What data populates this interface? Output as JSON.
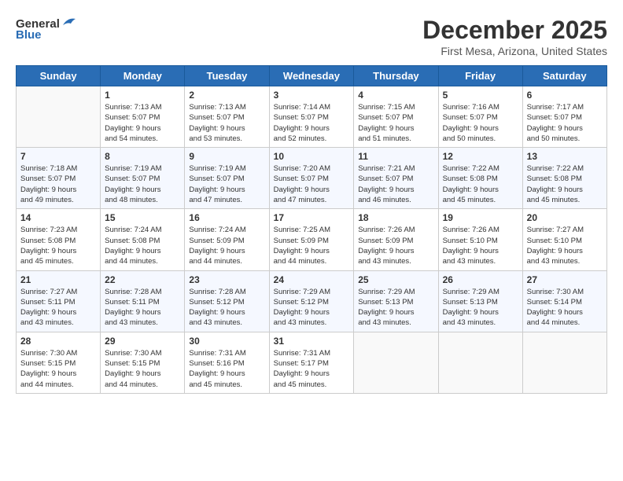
{
  "header": {
    "logo_line1": "General",
    "logo_line2": "Blue",
    "title": "December 2025",
    "subtitle": "First Mesa, Arizona, United States"
  },
  "days_of_week": [
    "Sunday",
    "Monday",
    "Tuesday",
    "Wednesday",
    "Thursday",
    "Friday",
    "Saturday"
  ],
  "weeks": [
    [
      {
        "day": "",
        "info": ""
      },
      {
        "day": "1",
        "info": "Sunrise: 7:13 AM\nSunset: 5:07 PM\nDaylight: 9 hours\nand 54 minutes."
      },
      {
        "day": "2",
        "info": "Sunrise: 7:13 AM\nSunset: 5:07 PM\nDaylight: 9 hours\nand 53 minutes."
      },
      {
        "day": "3",
        "info": "Sunrise: 7:14 AM\nSunset: 5:07 PM\nDaylight: 9 hours\nand 52 minutes."
      },
      {
        "day": "4",
        "info": "Sunrise: 7:15 AM\nSunset: 5:07 PM\nDaylight: 9 hours\nand 51 minutes."
      },
      {
        "day": "5",
        "info": "Sunrise: 7:16 AM\nSunset: 5:07 PM\nDaylight: 9 hours\nand 50 minutes."
      },
      {
        "day": "6",
        "info": "Sunrise: 7:17 AM\nSunset: 5:07 PM\nDaylight: 9 hours\nand 50 minutes."
      }
    ],
    [
      {
        "day": "7",
        "info": "Sunrise: 7:18 AM\nSunset: 5:07 PM\nDaylight: 9 hours\nand 49 minutes."
      },
      {
        "day": "8",
        "info": "Sunrise: 7:19 AM\nSunset: 5:07 PM\nDaylight: 9 hours\nand 48 minutes."
      },
      {
        "day": "9",
        "info": "Sunrise: 7:19 AM\nSunset: 5:07 PM\nDaylight: 9 hours\nand 47 minutes."
      },
      {
        "day": "10",
        "info": "Sunrise: 7:20 AM\nSunset: 5:07 PM\nDaylight: 9 hours\nand 47 minutes."
      },
      {
        "day": "11",
        "info": "Sunrise: 7:21 AM\nSunset: 5:07 PM\nDaylight: 9 hours\nand 46 minutes."
      },
      {
        "day": "12",
        "info": "Sunrise: 7:22 AM\nSunset: 5:08 PM\nDaylight: 9 hours\nand 45 minutes."
      },
      {
        "day": "13",
        "info": "Sunrise: 7:22 AM\nSunset: 5:08 PM\nDaylight: 9 hours\nand 45 minutes."
      }
    ],
    [
      {
        "day": "14",
        "info": "Sunrise: 7:23 AM\nSunset: 5:08 PM\nDaylight: 9 hours\nand 45 minutes."
      },
      {
        "day": "15",
        "info": "Sunrise: 7:24 AM\nSunset: 5:08 PM\nDaylight: 9 hours\nand 44 minutes."
      },
      {
        "day": "16",
        "info": "Sunrise: 7:24 AM\nSunset: 5:09 PM\nDaylight: 9 hours\nand 44 minutes."
      },
      {
        "day": "17",
        "info": "Sunrise: 7:25 AM\nSunset: 5:09 PM\nDaylight: 9 hours\nand 44 minutes."
      },
      {
        "day": "18",
        "info": "Sunrise: 7:26 AM\nSunset: 5:09 PM\nDaylight: 9 hours\nand 43 minutes."
      },
      {
        "day": "19",
        "info": "Sunrise: 7:26 AM\nSunset: 5:10 PM\nDaylight: 9 hours\nand 43 minutes."
      },
      {
        "day": "20",
        "info": "Sunrise: 7:27 AM\nSunset: 5:10 PM\nDaylight: 9 hours\nand 43 minutes."
      }
    ],
    [
      {
        "day": "21",
        "info": "Sunrise: 7:27 AM\nSunset: 5:11 PM\nDaylight: 9 hours\nand 43 minutes."
      },
      {
        "day": "22",
        "info": "Sunrise: 7:28 AM\nSunset: 5:11 PM\nDaylight: 9 hours\nand 43 minutes."
      },
      {
        "day": "23",
        "info": "Sunrise: 7:28 AM\nSunset: 5:12 PM\nDaylight: 9 hours\nand 43 minutes."
      },
      {
        "day": "24",
        "info": "Sunrise: 7:29 AM\nSunset: 5:12 PM\nDaylight: 9 hours\nand 43 minutes."
      },
      {
        "day": "25",
        "info": "Sunrise: 7:29 AM\nSunset: 5:13 PM\nDaylight: 9 hours\nand 43 minutes."
      },
      {
        "day": "26",
        "info": "Sunrise: 7:29 AM\nSunset: 5:13 PM\nDaylight: 9 hours\nand 43 minutes."
      },
      {
        "day": "27",
        "info": "Sunrise: 7:30 AM\nSunset: 5:14 PM\nDaylight: 9 hours\nand 44 minutes."
      }
    ],
    [
      {
        "day": "28",
        "info": "Sunrise: 7:30 AM\nSunset: 5:15 PM\nDaylight: 9 hours\nand 44 minutes."
      },
      {
        "day": "29",
        "info": "Sunrise: 7:30 AM\nSunset: 5:15 PM\nDaylight: 9 hours\nand 44 minutes."
      },
      {
        "day": "30",
        "info": "Sunrise: 7:31 AM\nSunset: 5:16 PM\nDaylight: 9 hours\nand 45 minutes."
      },
      {
        "day": "31",
        "info": "Sunrise: 7:31 AM\nSunset: 5:17 PM\nDaylight: 9 hours\nand 45 minutes."
      },
      {
        "day": "",
        "info": ""
      },
      {
        "day": "",
        "info": ""
      },
      {
        "day": "",
        "info": ""
      }
    ]
  ]
}
